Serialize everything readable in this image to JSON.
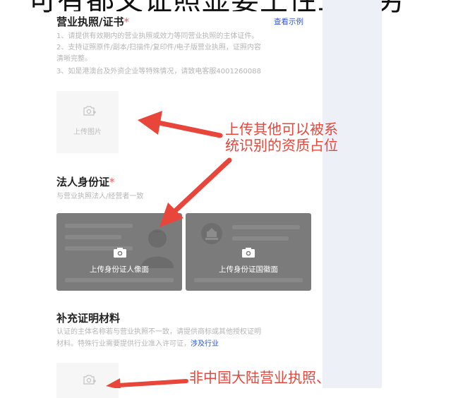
{
  "top_banner_text": "可有都文证照显要土性工作另",
  "license_section": {
    "title": "营业执照/证书",
    "required_mark": "*",
    "example_link": "查看示例",
    "notes": [
      "1、请提供有效期内的营业执照或效力等同营业执照的主体证件。",
      "2、支持证照原件/副本/扫描件/复印件/电子版营业执照，证照内容",
      "清晰完整。",
      "3、如是港澳台及外资企业等特殊情况，请致电客服4001260088"
    ],
    "upload_label": "上传图片"
  },
  "id_section": {
    "title": "法人身份证",
    "required_mark": "*",
    "hint": "与营业执照法人/经营者一致",
    "front_label": "上传身份证人像面",
    "back_label": "上传身份证国徽面"
  },
  "supplement_section": {
    "title": "补充证明材料",
    "notes_line1": "认证的主体名称若与营业执照不一致，请提供商标或其他授权证明",
    "notes_line2": "材料。特殊行业需要提供行业准入许可证，",
    "industry_link": "涉及行业"
  },
  "annotations": {
    "first_line1": "上传其他可以被系",
    "first_line2": "统识别的资质占位",
    "second": "非中国大陆营业执照、"
  },
  "colors": {
    "accent_blue": "#2c54d6",
    "required_red": "#f2565c",
    "annotation_red": "#e8463a",
    "id_card_gray": "#7b7b7b",
    "side_band": "#eef0f8"
  },
  "icons": [
    "camera-plus-icon",
    "camera-icon",
    "person-silhouette-icon",
    "emblem-icon",
    "arrow-icon"
  ]
}
